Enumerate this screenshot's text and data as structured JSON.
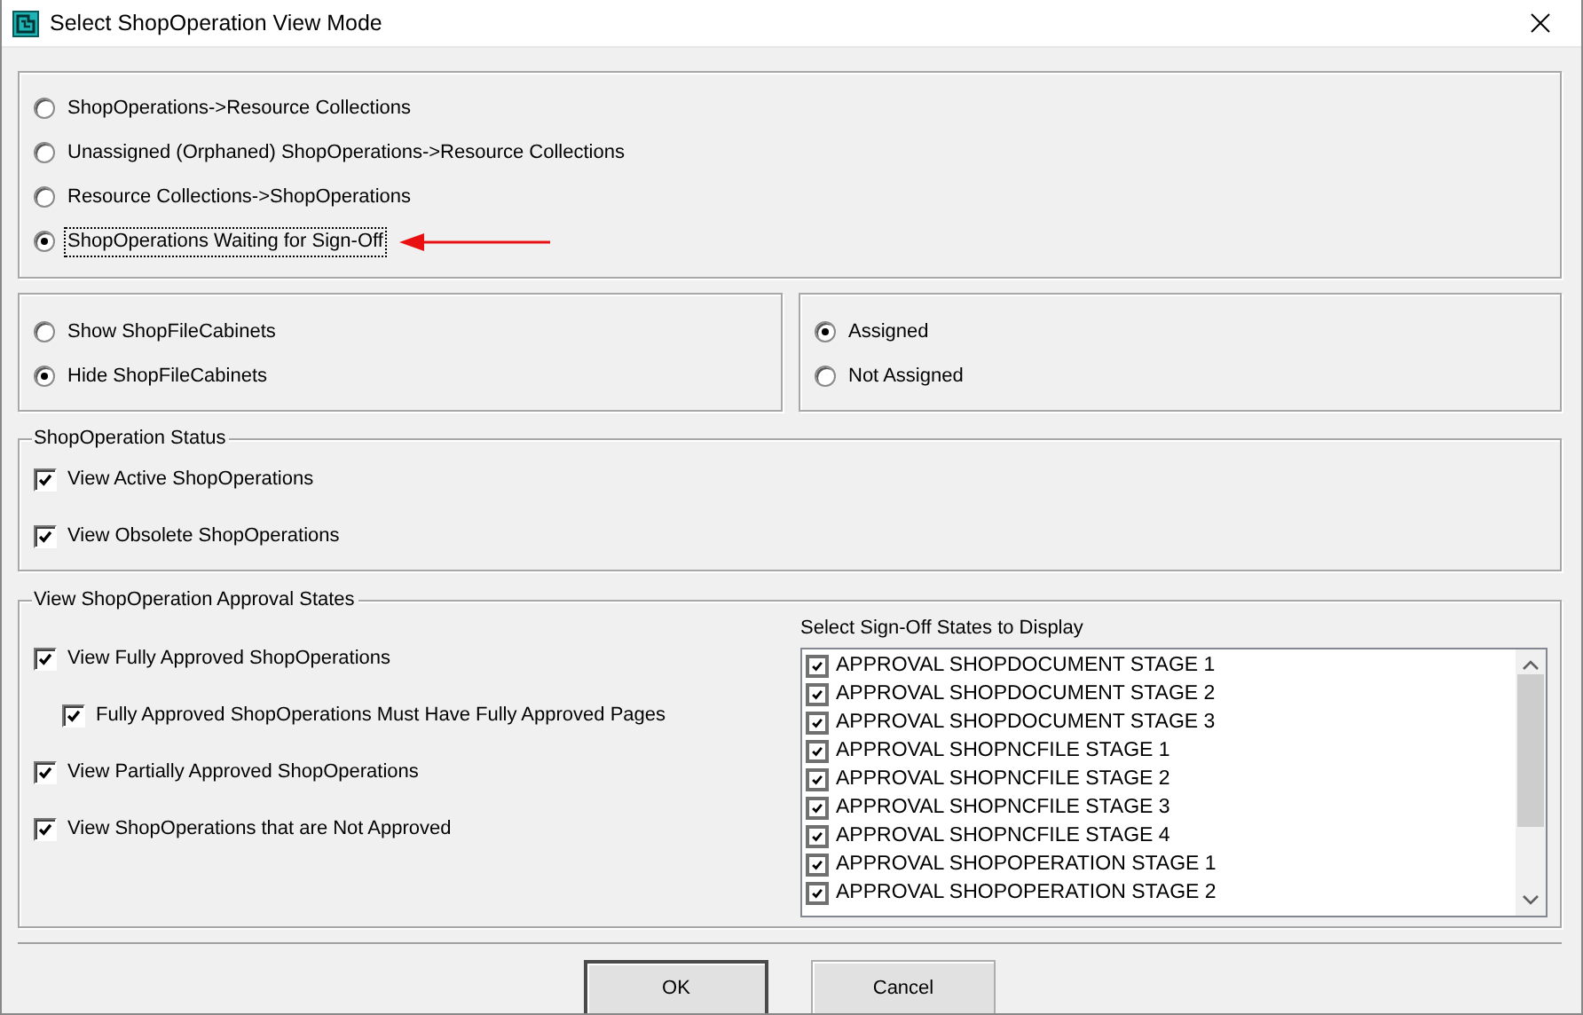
{
  "window": {
    "title": "Select ShopOperation View Mode"
  },
  "view_modes": [
    {
      "label": "ShopOperations->Resource Collections",
      "selected": false,
      "focused": false
    },
    {
      "label": "Unassigned (Orphaned) ShopOperations->Resource Collections",
      "selected": false,
      "focused": false
    },
    {
      "label": "Resource Collections->ShopOperations",
      "selected": false,
      "focused": false
    },
    {
      "label": "ShopOperations Waiting for Sign-Off",
      "selected": true,
      "focused": true
    }
  ],
  "file_cabinets": [
    {
      "label": "Show ShopFileCabinets",
      "selected": false
    },
    {
      "label": "Hide ShopFileCabinets",
      "selected": true
    }
  ],
  "assignment": [
    {
      "label": "Assigned",
      "selected": true
    },
    {
      "label": "Not Assigned",
      "selected": false
    }
  ],
  "status_group": {
    "title": "ShopOperation Status",
    "options": [
      {
        "label": "View Active ShopOperations",
        "checked": true
      },
      {
        "label": "View Obsolete ShopOperations",
        "checked": true
      }
    ]
  },
  "approval_group": {
    "title": "View ShopOperation Approval States",
    "options": [
      {
        "label": "View Fully Approved ShopOperations",
        "checked": true,
        "children": [
          {
            "label": "Fully Approved ShopOperations Must Have Fully Approved Pages",
            "checked": true
          }
        ]
      },
      {
        "label": "View Partially Approved ShopOperations",
        "checked": true
      },
      {
        "label": "View ShopOperations that are Not Approved",
        "checked": true
      }
    ],
    "signoff_list": {
      "label": "Select Sign-Off States to Display",
      "items": [
        {
          "label": "APPROVAL SHOPDOCUMENT STAGE 1",
          "checked": true
        },
        {
          "label": "APPROVAL SHOPDOCUMENT STAGE 2",
          "checked": true
        },
        {
          "label": "APPROVAL SHOPDOCUMENT STAGE 3",
          "checked": true
        },
        {
          "label": "APPROVAL SHOPNCFILE STAGE 1",
          "checked": true
        },
        {
          "label": "APPROVAL SHOPNCFILE STAGE 2",
          "checked": true
        },
        {
          "label": "APPROVAL SHOPNCFILE STAGE 3",
          "checked": true
        },
        {
          "label": "APPROVAL SHOPNCFILE STAGE 4",
          "checked": true
        },
        {
          "label": "APPROVAL SHOPOPERATION STAGE 1",
          "checked": true
        },
        {
          "label": "APPROVAL SHOPOPERATION STAGE 2",
          "checked": true
        }
      ]
    }
  },
  "buttons": [
    {
      "label": "OK",
      "default": true
    },
    {
      "label": "Cancel",
      "default": false
    }
  ]
}
